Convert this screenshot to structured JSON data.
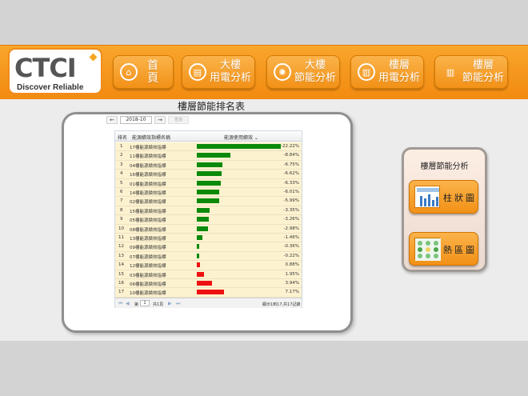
{
  "logo": {
    "main": "CTCI",
    "tagline": "Discover Reliable"
  },
  "nav": [
    {
      "line1": "首 頁",
      "line2": "",
      "icon": "home-icon"
    },
    {
      "line1": "大樓",
      "line2": "用電分析",
      "icon": "monitor-chart-icon"
    },
    {
      "line1": "大樓",
      "line2": "節能分析",
      "icon": "lightbulb-icon"
    },
    {
      "line1": "樓層",
      "line2": "用電分析",
      "icon": "factory-icon"
    },
    {
      "line1": "樓層",
      "line2": "節能分析",
      "icon": "factory-icon"
    }
  ],
  "page_title": "樓層節能排名表",
  "date_nav": {
    "prev": "←",
    "date": "2018-10",
    "next": "→",
    "query": "查詢"
  },
  "grid": {
    "headers": {
      "rank": "排名",
      "name": "能源績效指標名稱",
      "perf": "能源使用績效 ⌄"
    },
    "rows": [
      {
        "rank": "1",
        "name": "17樓能源績效指標",
        "value": "-22.22%",
        "num": -22.22
      },
      {
        "rank": "2",
        "name": "11樓能源績效指標",
        "value": "-8.84%",
        "num": -8.84
      },
      {
        "rank": "3",
        "name": "04樓能源績效指標",
        "value": "-6.75%",
        "num": -6.75
      },
      {
        "rank": "4",
        "name": "16樓能源績效指標",
        "value": "-6.62%",
        "num": -6.62
      },
      {
        "rank": "5",
        "name": "01樓能源績效指標",
        "value": "-6.33%",
        "num": -6.33
      },
      {
        "rank": "6",
        "name": "14樓能源績效指標",
        "value": "-6.01%",
        "num": -6.01
      },
      {
        "rank": "7",
        "name": "02樓能源績效指標",
        "value": "-5.99%",
        "num": -5.99
      },
      {
        "rank": "8",
        "name": "15樓能源績效指標",
        "value": "-3.35%",
        "num": -3.35
      },
      {
        "rank": "9",
        "name": "05樓能源績效指標",
        "value": "-3.26%",
        "num": -3.26
      },
      {
        "rank": "10",
        "name": "08樓能源績效指標",
        "value": "-2.98%",
        "num": -2.98
      },
      {
        "rank": "11",
        "name": "13樓能源績效指標",
        "value": "-1.46%",
        "num": -1.46
      },
      {
        "rank": "12",
        "name": "09樓能源績效指標",
        "value": "-0.36%",
        "num": -0.36
      },
      {
        "rank": "13",
        "name": "07樓能源績效指標",
        "value": "-0.22%",
        "num": -0.22
      },
      {
        "rank": "14",
        "name": "12樓能源績效指標",
        "value": "0.88%",
        "num": 0.88
      },
      {
        "rank": "15",
        "name": "03樓能源績效指標",
        "value": "1.95%",
        "num": 1.95
      },
      {
        "rank": "16",
        "name": "06樓能源績效指標",
        "value": "3.94%",
        "num": 3.94
      },
      {
        "rank": "17",
        "name": "10樓能源績效指標",
        "value": "7.17%",
        "num": 7.17
      }
    ],
    "colors": {
      "negative": "#0a8a0a",
      "positive": "#ee1111"
    },
    "footer": {
      "first": "⏮",
      "prev": "◀",
      "page_label": "第",
      "page": "1",
      "total": "共1頁",
      "next": "▶",
      "last": "⏭",
      "summary": "顯示1到17,共17記錄"
    }
  },
  "side": {
    "title": "樓層節能分析",
    "buttons": [
      {
        "label": "柱狀圖",
        "icon": "bar-chart-icon"
      },
      {
        "label": "熱區圖",
        "icon": "heatmap-icon"
      }
    ]
  }
}
